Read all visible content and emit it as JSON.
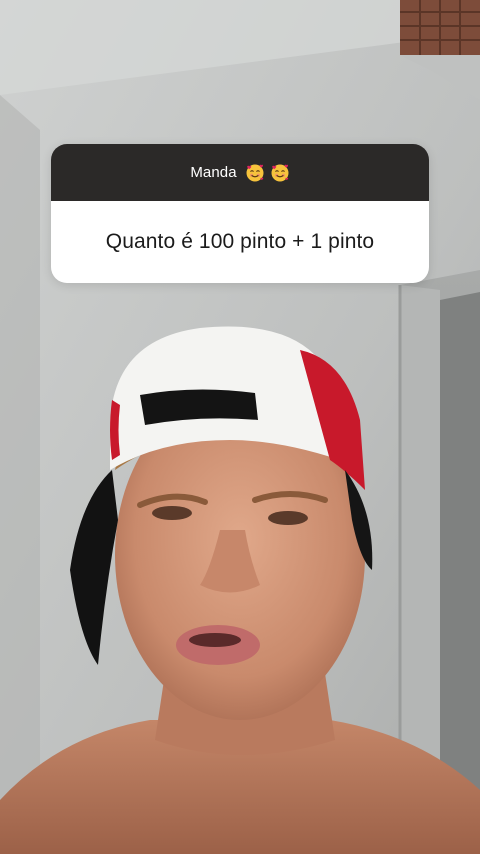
{
  "question_sticker": {
    "prompt": "Manda",
    "prompt_emojis": [
      "smiling-face-with-hearts-icon",
      "smiling-face-with-hearts-icon"
    ],
    "question": "Quanto é 100 pinto + 1 pinto",
    "header_color": "#2b2928",
    "body_color": "#ffffff"
  },
  "background": {
    "wall_color": "#c4c6c5",
    "cap_colors": [
      "#ffffff",
      "#c8192b",
      "#111111"
    ]
  }
}
